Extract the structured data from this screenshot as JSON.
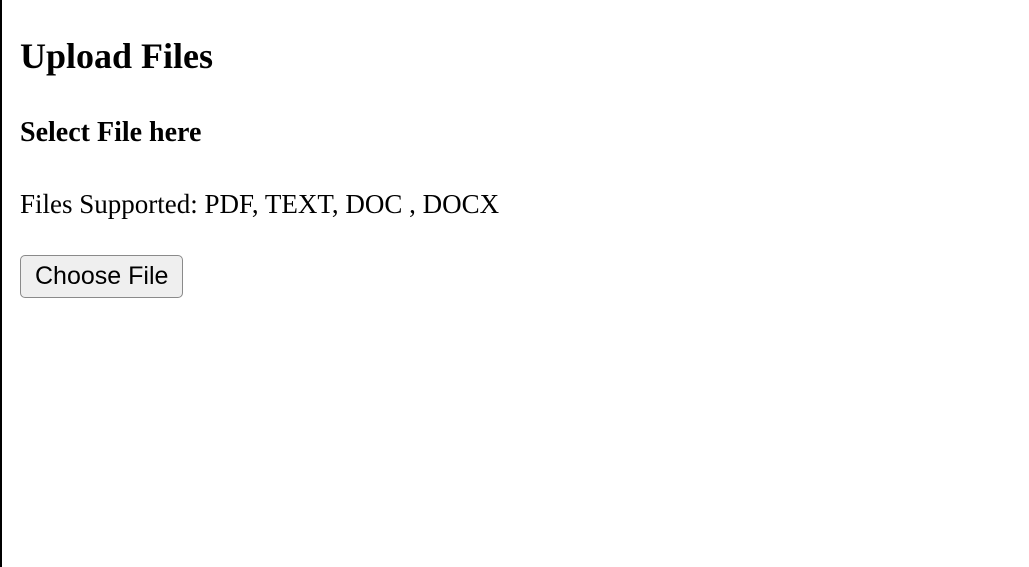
{
  "header": {
    "title": "Upload Files"
  },
  "main": {
    "subtitle": "Select File here",
    "supported_text": "Files Supported: PDF, TEXT, DOC , DOCX",
    "choose_file_label": "Choose File"
  }
}
